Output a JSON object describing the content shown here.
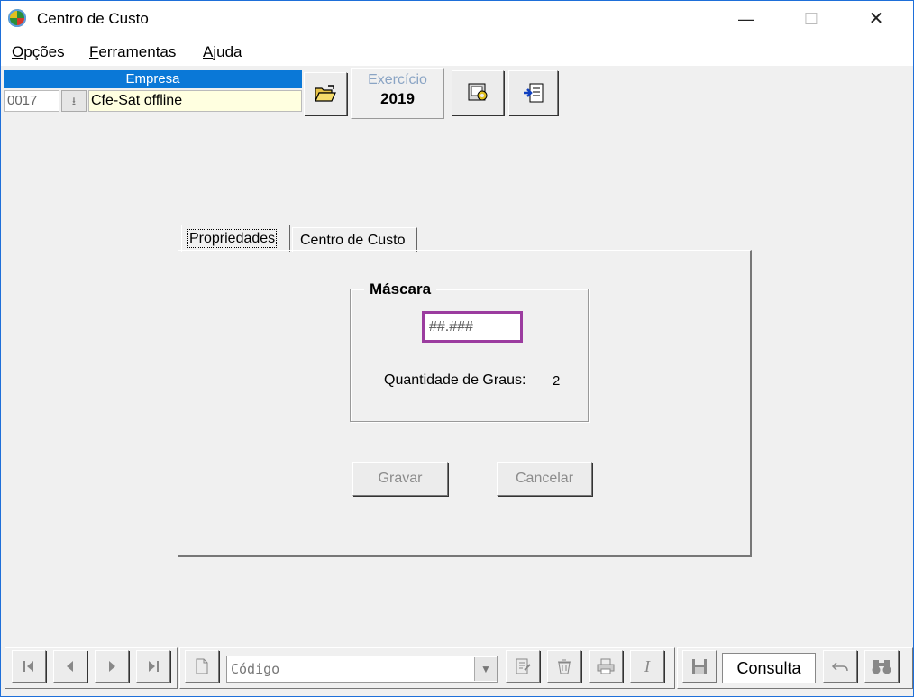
{
  "window": {
    "title": "Centro de Custo",
    "controls": {
      "minimize": "—",
      "maximize": "☐",
      "close": "✕"
    }
  },
  "menu": {
    "opcoes": {
      "first": "O",
      "rest": "pções"
    },
    "ferramentas": {
      "first": "F",
      "rest": "erramentas"
    },
    "ajuda": {
      "first": "A",
      "rest": "juda"
    }
  },
  "toolbar": {
    "empresa_header": "Empresa",
    "empresa_code": "0017",
    "empresa_name": "Cfe-Sat offline",
    "exercicio_label": "Exercício",
    "exercicio_value": "2019",
    "icons": [
      "open-folder-icon",
      "config-icon",
      "exit-icon"
    ]
  },
  "tabs": [
    {
      "label": "Propriedades",
      "active": true
    },
    {
      "label": "Centro de Custo",
      "active": false
    }
  ],
  "mascara": {
    "title": "Máscara",
    "value": "##.###",
    "graus_label": "Quantidade de Graus:",
    "graus_value": "2"
  },
  "buttons": {
    "gravar": "Gravar",
    "cancelar": "Cancelar"
  },
  "navbar": {
    "codigo_placeholder": "Código",
    "consulta": "Consulta"
  },
  "colors": {
    "accent": "#0a78d7",
    "mask_border": "#9b3c9f",
    "empresa_bg": "#ffffe0"
  }
}
